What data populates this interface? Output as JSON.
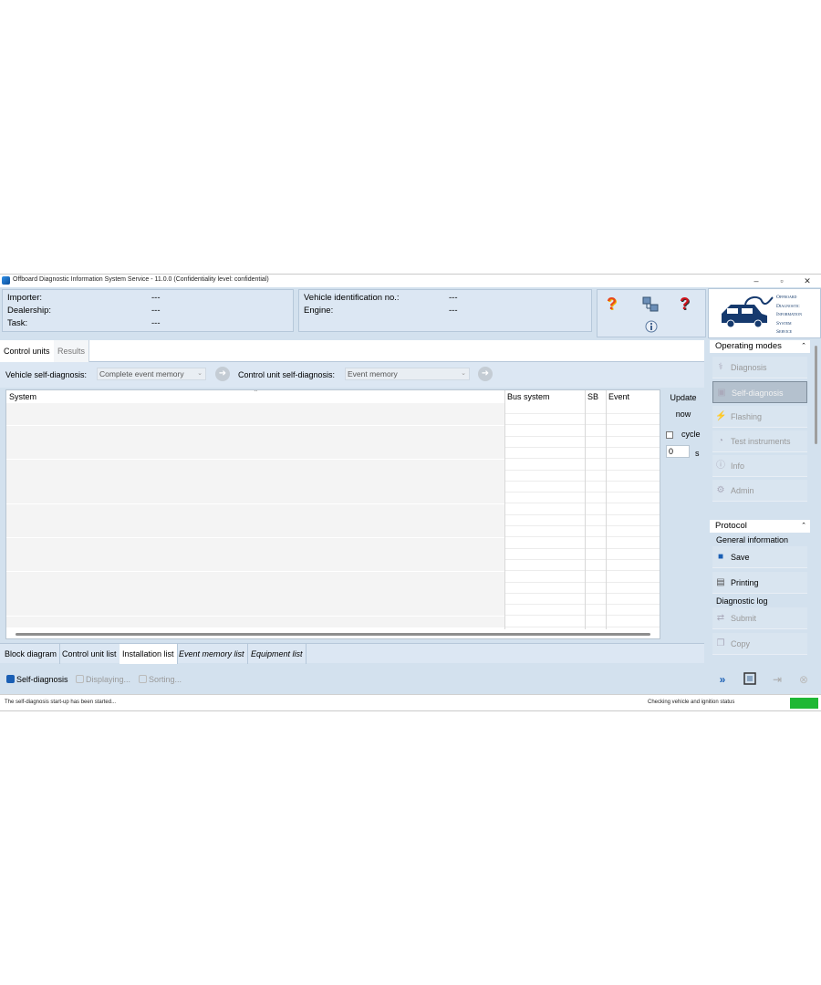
{
  "window": {
    "title": "Offboard Diagnostic Information System Service - 11.0.0 (Confidentiality level: confidential)",
    "minimize": "–",
    "restore": "▫",
    "close": "✕"
  },
  "header": {
    "left": [
      {
        "label": "Importer:",
        "value": "---"
      },
      {
        "label": "Dealership:",
        "value": "---"
      },
      {
        "label": "Task:",
        "value": "---"
      }
    ],
    "middle": [
      {
        "label": "Vehicle identification no.:",
        "value": "---"
      },
      {
        "label": "Engine:",
        "value": "---"
      }
    ],
    "logo_lines": [
      "Offboard",
      "Diagnostic",
      "Information",
      "System",
      "Service"
    ]
  },
  "tabs": [
    {
      "label": "Control units",
      "active": true
    },
    {
      "label": "Results",
      "active": false
    }
  ],
  "filters": {
    "vehicle_label": "Vehicle self-diagnosis:",
    "vehicle_value": "Complete event memory",
    "cu_label": "Control unit self-diagnosis:",
    "cu_value": "Event memory"
  },
  "grid": {
    "columns": [
      "System",
      "Bus system",
      "SB",
      "Event"
    ]
  },
  "update": {
    "line1": "Update",
    "line2": "now",
    "cycle": "cycle",
    "seconds_value": "0",
    "seconds_unit": "s"
  },
  "bottom_tabs": [
    {
      "label": "Block diagram",
      "italic": false
    },
    {
      "label": "Control unit list",
      "italic": false
    },
    {
      "label": "Installation list",
      "italic": false
    },
    {
      "label": "Event memory list",
      "italic": true
    },
    {
      "label": "Equipment list",
      "italic": true
    }
  ],
  "actions": [
    {
      "label": "Self-diagnosis",
      "enabled": true
    },
    {
      "label": "Displaying...",
      "enabled": false
    },
    {
      "label": "Sorting...",
      "enabled": false
    }
  ],
  "sidebar": {
    "operating_modes": "Operating modes",
    "modes": [
      {
        "label": "Diagnosis",
        "state": "disabled"
      },
      {
        "label": "Self-diagnosis",
        "state": "selected"
      },
      {
        "label": "Flashing",
        "state": "disabled"
      },
      {
        "label": "Test instruments",
        "state": "disabled"
      },
      {
        "label": "Info",
        "state": "disabled"
      },
      {
        "label": "Admin",
        "state": "disabled"
      }
    ],
    "protocol": "Protocol",
    "general_information": "General information",
    "save": "Save",
    "printing": "Printing",
    "diagnostic_log": "Diagnostic log",
    "submit": "Submit",
    "copy": "Copy"
  },
  "status": {
    "left": "The self-diagnosis start-up has been started...",
    "right": "Checking vehicle and ignition status"
  },
  "colors": {
    "accent": "#1a5fb4",
    "panel": "#d3e1ee",
    "ok": "#1fb834"
  }
}
